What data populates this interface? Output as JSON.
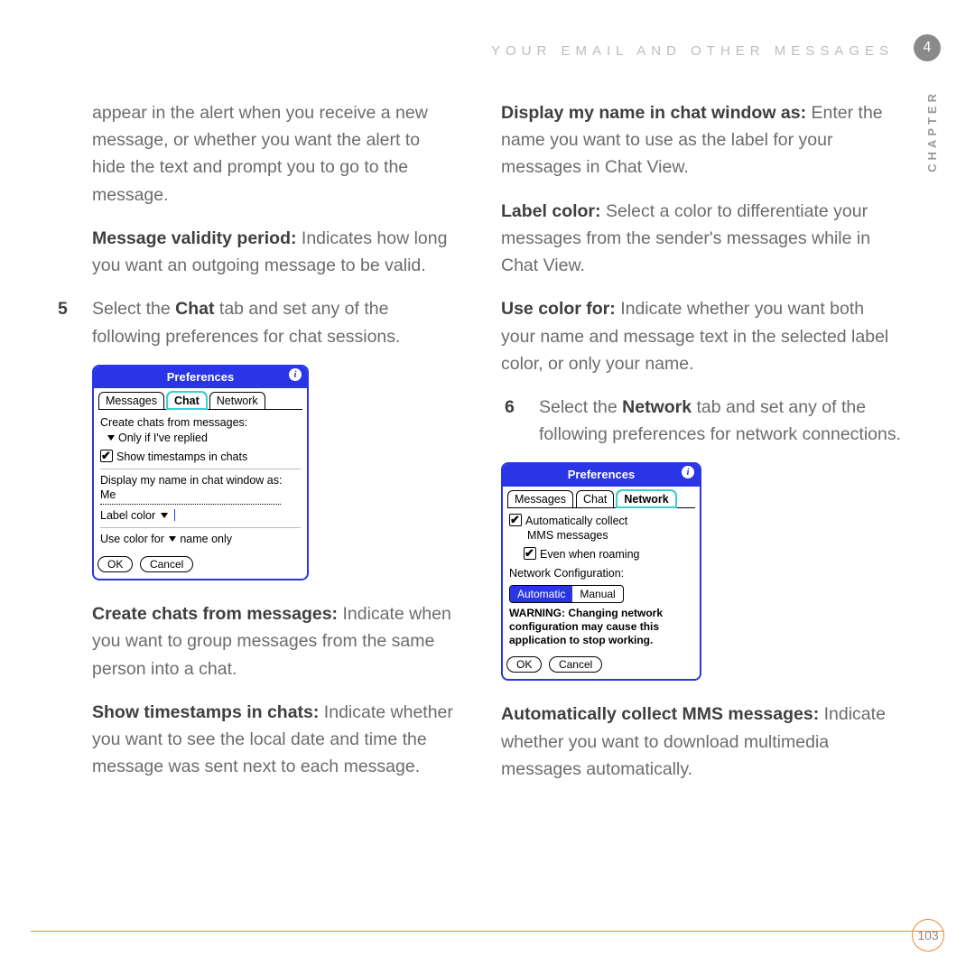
{
  "header": {
    "section_title": "YOUR EMAIL AND OTHER MESSAGES",
    "chapter_num": "4",
    "chapter_label": "CHAPTER"
  },
  "left": {
    "p1": "appear in the alert when you receive a new message, or whether you want the alert to hide the text and prompt you to go to the message.",
    "mvp_label": "Message validity period:",
    "mvp_text": " Indicates how long you want an outgoing message to be valid.",
    "step5_num": "5",
    "step5_pre": "Select the ",
    "step5_bold": "Chat",
    "step5_post": " tab and set any of the following preferences for chat sessions.",
    "chat_dialog": {
      "title": "Preferences",
      "tabs": [
        "Messages",
        "Chat",
        "Network"
      ],
      "create_label": "Create chats from messages:",
      "create_value": "Only if I've replied",
      "timestamps": "Show timestamps in chats",
      "display_label": "Display my name in chat window as:",
      "display_value": "Me",
      "label_color": "Label color",
      "use_color_pre": "Use color for",
      "use_color_val": "name only",
      "ok": "OK",
      "cancel": "Cancel"
    },
    "ccfm_label": "Create chats from messages:",
    "ccfm_text": " Indicate when you want to group messages from the same person into a chat.",
    "stic_label": "Show timestamps in chats:",
    "stic_text": " Indicate whether you want to see the local date and time the message was sent next to each message."
  },
  "right": {
    "dmn_label": "Display my name in chat window as:",
    "dmn_text": " Enter the name you want to use as the label for your messages in Chat View.",
    "lc_label": "Label color:",
    "lc_text": " Select a color to differentiate your messages from the sender's messages while in Chat View.",
    "ucf_label": "Use color for:",
    "ucf_text": " Indicate whether you want both your name and message text in the selected label color, or only your name.",
    "step6_num": "6",
    "step6_pre": "Select the ",
    "step6_bold": "Network",
    "step6_post": " tab and set any of the following preferences for network connections.",
    "net_dialog": {
      "title": "Preferences",
      "tabs": [
        "Messages",
        "Chat",
        "Network"
      ],
      "auto1": "Automatically collect",
      "auto2": "MMS messages",
      "roam": "Even when roaming",
      "conf": "Network Configuration:",
      "mode_auto": "Automatic",
      "mode_manual": "Manual",
      "warn": "WARNING: Changing network configuration may cause this application to stop working.",
      "ok": "OK",
      "cancel": "Cancel"
    },
    "acm_label": "Automatically collect MMS messages:",
    "acm_text": " Indicate whether you want to download multimedia messages automatically."
  },
  "footer": {
    "page": "103"
  }
}
